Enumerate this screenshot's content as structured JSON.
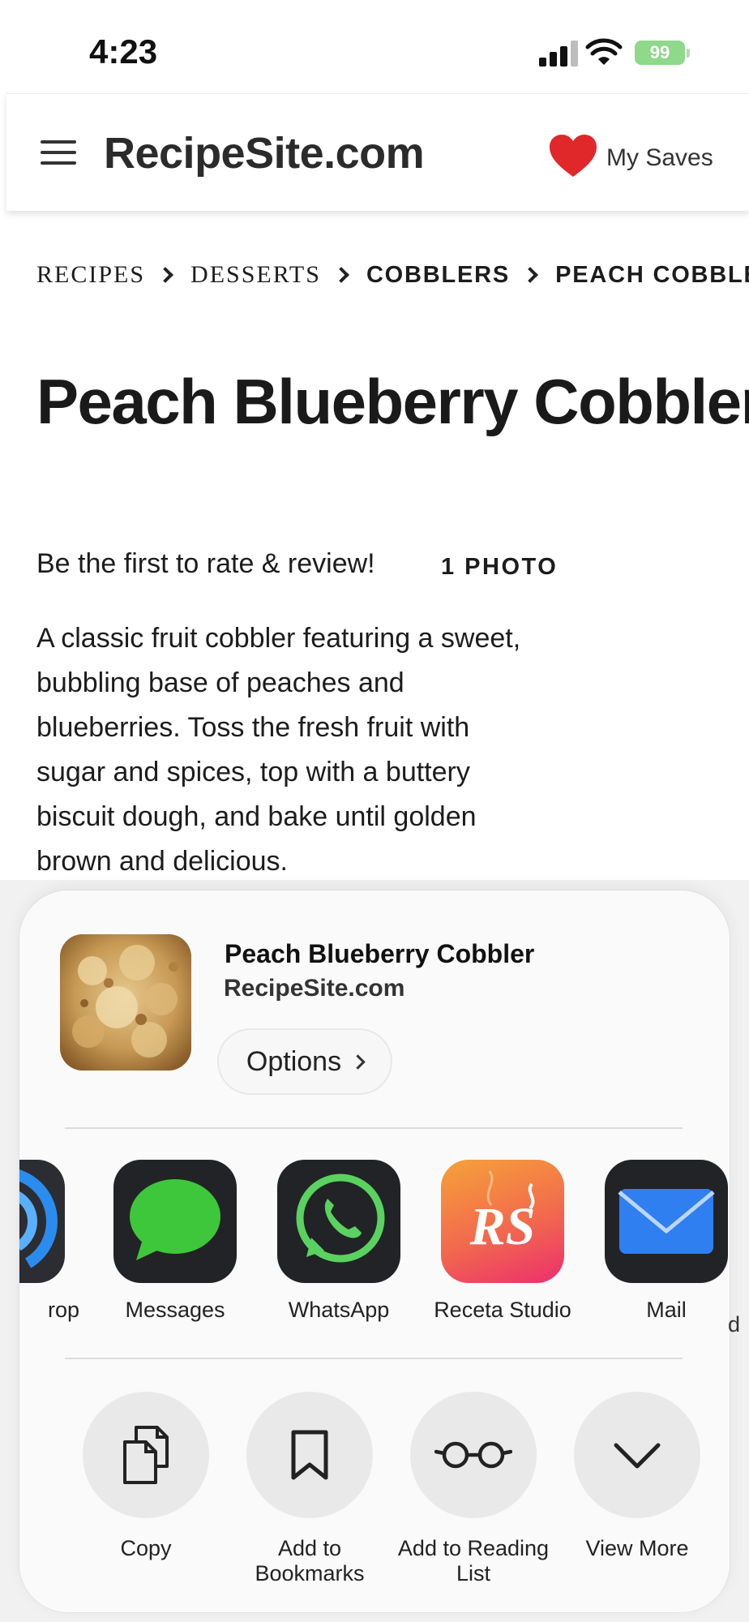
{
  "status_bar": {
    "time": "4:23",
    "battery": "99"
  },
  "header": {
    "site_title": "RecipeSite.com",
    "my_saves": "My Saves"
  },
  "breadcrumb": [
    "RECIPES",
    "DESSERTS",
    "COBBLERS",
    "PEACH COBBLER"
  ],
  "recipe": {
    "title": "Peach Blueberry Cobbler",
    "rate_prompt": "Be the first to rate & review!",
    "photo_count": "1 PHOTO",
    "description": "A classic fruit cobbler featuring a sweet, bubbling base of peaches and blueberries. Toss the fresh fruit with sugar and spices, top with a buttery biscuit dough, and bake until golden brown and delicious."
  },
  "share_sheet": {
    "title": "Peach Blueberry Cobbler",
    "site": "RecipeSite.com",
    "options_label": "Options",
    "apps": [
      {
        "label": "rop",
        "icon": "airdrop-icon"
      },
      {
        "label": "Messages",
        "icon": "messages-icon"
      },
      {
        "label": "WhatsApp",
        "icon": "whatsapp-icon"
      },
      {
        "label": "Receta Studio",
        "icon": "receta-studio-icon"
      },
      {
        "label": "Mail",
        "icon": "mail-icon"
      },
      {
        "label": "d",
        "icon": ""
      }
    ],
    "actions": [
      {
        "label": "Copy",
        "icon": "copy-icon"
      },
      {
        "label": "Add to Bookmarks",
        "icon": "bookmark-icon"
      },
      {
        "label": "Add to Reading List",
        "icon": "glasses-icon"
      },
      {
        "label": "View More",
        "icon": "chevron-down-icon"
      }
    ]
  },
  "colors": {
    "heart": "#e0282b",
    "messages_green": "#3ec73a",
    "whatsapp_green": "#5ad260",
    "receta_gradient_start": "#f6a23a",
    "receta_gradient_end": "#ec2e6e",
    "mail_blue": "#2f7ff0",
    "battery_green": "#8fd98a"
  }
}
